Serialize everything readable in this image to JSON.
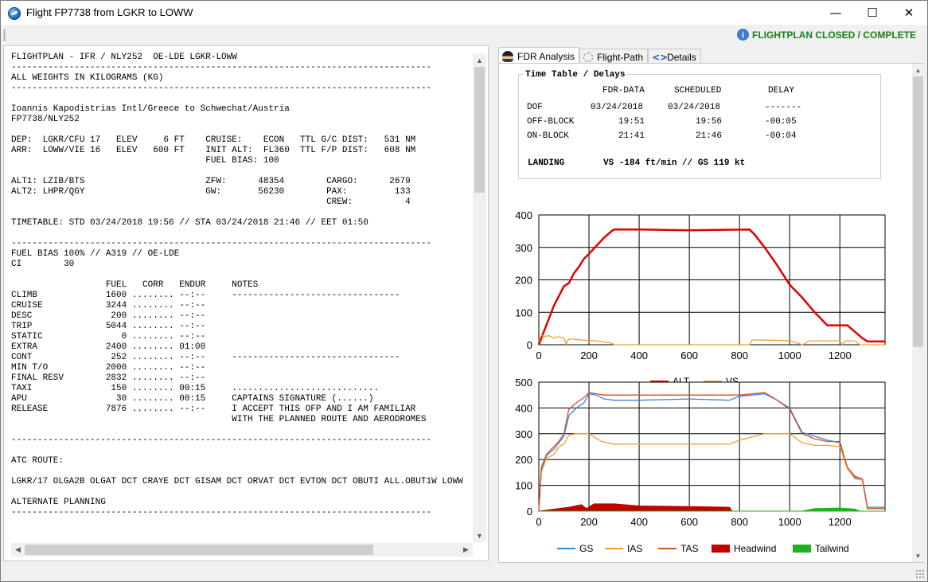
{
  "window": {
    "title": "Flight FP7738 from LGKR to LOWW",
    "minimize": "—",
    "maximize": "☐",
    "close": "✕"
  },
  "status": {
    "text": "FLIGHTPLAN CLOSED / COMPLETE",
    "color": "#1a7f1a",
    "icon": "info-icon"
  },
  "flightplan_text": "FLIGHTPLAN - IFR / NLY252  OE-LDE LGKR-LOWW\n--------------------------------------------------------------------------------\nALL WEIGHTS IN KILOGRAMS (KG)\n--------------------------------------------------------------------------------\n\nIoannis Kapodistrias Intl/Greece to Schwechat/Austria\nFP7738/NLY252\n\nDEP:  LGKR/CFU 17   ELEV     6 FT    CRUISE:    ECON   TTL G/C DIST:   531 NM\nARR:  LOWW/VIE 16   ELEV   600 FT    INIT ALT:  FL360  TTL F/P DIST:   608 NM\n                                     FUEL BIAS: 100\n\nALT1: LZIB/BTS                       ZFW:      48354        CARGO:      2679\nALT2: LHPR/QGY                       GW:       56230        PAX:         133\n                                                            CREW:          4\n\nTIMETABLE: STD 03/24/2018 19:56 // STA 03/24/2018 21:46 // EET 01:50\n\n--------------------------------------------------------------------------------\nFUEL BIAS 100% // A319 // OE-LDE\nCI        30\n\n                  FUEL   CORR   ENDUR     NOTES\nCLIMB             1600 ........ --:--     --------------------------------\nCRUISE            3244 ........ --:--\nDESC               200 ........ --:--\nTRIP              5044 ........ --:--\nSTATIC               0 ........ --:--\nEXTRA             2400 ........ 01:00\nCONT               252 ........ --:--     --------------------------------\nMIN T/O           2000 ........ --:--\nFINAL RESV        2832 ........ --:--\nTAXI               150 ........ 00:15     ............................\nAPU                 30 ........ 00:15     CAPTAINS SIGNATURE (......)\nRELEASE           7876 ........ --:--     I ACCEPT THIS OFP AND I AM FAMILIAR\n                                          WITH THE PLANNED ROUTE AND AERODROMES\n\n--------------------------------------------------------------------------------\n\nATC ROUTE:\n\nLGKR/17 OLGA2B OLGAT DCT CRAYE DCT GISAM DCT ORVAT DCT EVTON DCT OBUTI ALL.OBUT1W LOWW\n\nALTERNATE PLANNING\n--------------------------------------------------------------------------------",
  "tabs": [
    {
      "label": "FDR Analysis",
      "icon": "pilot-icon",
      "active": true
    },
    {
      "label": "Flight-Path",
      "icon": "route-icon",
      "active": false
    },
    {
      "label": "Details",
      "icon": "details-icon",
      "active": false
    }
  ],
  "timetable": {
    "title": "Time Table / Delays",
    "col_fdr": "FDR-DATA",
    "col_sched": "SCHEDULED",
    "col_delay": "DELAY",
    "rows": [
      {
        "label": "DOF",
        "fdr": "03/24/2018",
        "sched": "03/24/2018",
        "delay": "-------"
      },
      {
        "label": "OFF-BLOCK",
        "fdr": "19:51",
        "sched": "19:56",
        "delay": "-00:05"
      },
      {
        "label": "ON-BLOCK",
        "fdr": "21:41",
        "sched": "21:46",
        "delay": "-00:04"
      }
    ],
    "landing_label": "LANDING",
    "landing_value": "VS -184 ft/min // GS 119 kt"
  },
  "chart_data": [
    {
      "type": "line",
      "xlim": [
        0,
        1380
      ],
      "ylim": [
        0,
        400
      ],
      "xticks": [
        "0",
        "200",
        "400",
        "600",
        "800",
        "1000",
        "1200"
      ],
      "yticks": [
        "0",
        "100",
        "200",
        "300",
        "400"
      ],
      "grid": true,
      "legend": "bottom",
      "series": [
        {
          "name": "ALT",
          "color": "#e00000",
          "points": [
            [
              0,
              0
            ],
            [
              20,
              40
            ],
            [
              40,
              80
            ],
            [
              60,
              120
            ],
            [
              80,
              150
            ],
            [
              100,
              180
            ],
            [
              120,
              190
            ],
            [
              140,
              220
            ],
            [
              160,
              240
            ],
            [
              180,
              265
            ],
            [
              200,
              280
            ],
            [
              230,
              305
            ],
            [
              260,
              330
            ],
            [
              290,
              350
            ],
            [
              300,
              355
            ],
            [
              400,
              355
            ],
            [
              600,
              353
            ],
            [
              840,
              355
            ],
            [
              860,
              340
            ],
            [
              900,
              300
            ],
            [
              950,
              245
            ],
            [
              1000,
              185
            ],
            [
              1050,
              145
            ],
            [
              1100,
              100
            ],
            [
              1150,
              60
            ],
            [
              1200,
              60
            ],
            [
              1230,
              60
            ],
            [
              1260,
              40
            ],
            [
              1290,
              20
            ],
            [
              1310,
              10
            ],
            [
              1380,
              10
            ]
          ]
        },
        {
          "name": "VS",
          "color": "#f0a030",
          "points": [
            [
              0,
              10
            ],
            [
              10,
              30
            ],
            [
              20,
              25
            ],
            [
              40,
              28
            ],
            [
              60,
              20
            ],
            [
              80,
              25
            ],
            [
              100,
              20
            ],
            [
              110,
              0
            ],
            [
              115,
              15
            ],
            [
              130,
              18
            ],
            [
              180,
              14
            ],
            [
              230,
              12
            ],
            [
              290,
              5
            ],
            [
              300,
              0
            ],
            [
              840,
              0
            ],
            [
              850,
              15
            ],
            [
              900,
              14
            ],
            [
              1000,
              13
            ],
            [
              1050,
              0
            ],
            [
              1080,
              12
            ],
            [
              1150,
              12
            ],
            [
              1200,
              12
            ],
            [
              1210,
              0
            ],
            [
              1225,
              12
            ],
            [
              1260,
              12
            ],
            [
              1280,
              0
            ],
            [
              1380,
              0
            ]
          ]
        }
      ]
    },
    {
      "type": "line",
      "xlim": [
        0,
        1380
      ],
      "ylim": [
        0,
        500
      ],
      "xticks": [
        "0",
        "200",
        "400",
        "600",
        "800",
        "1000",
        "1200"
      ],
      "yticks": [
        "0",
        "100",
        "200",
        "300",
        "400",
        "500"
      ],
      "grid": true,
      "legend": "bottom",
      "series": [
        {
          "name": "GS",
          "color": "#3a86d4",
          "points": [
            [
              0,
              0
            ],
            [
              10,
              160
            ],
            [
              30,
              215
            ],
            [
              60,
              240
            ],
            [
              80,
              265
            ],
            [
              100,
              290
            ],
            [
              120,
              370
            ],
            [
              150,
              400
            ],
            [
              180,
              420
            ],
            [
              200,
              455
            ],
            [
              230,
              450
            ],
            [
              260,
              435
            ],
            [
              300,
              430
            ],
            [
              400,
              430
            ],
            [
              600,
              435
            ],
            [
              760,
              430
            ],
            [
              800,
              445
            ],
            [
              900,
              455
            ],
            [
              950,
              430
            ],
            [
              1000,
              400
            ],
            [
              1050,
              305
            ],
            [
              1100,
              290
            ],
            [
              1150,
              275
            ],
            [
              1200,
              265
            ],
            [
              1230,
              170
            ],
            [
              1260,
              130
            ],
            [
              1290,
              125
            ],
            [
              1310,
              15
            ],
            [
              1380,
              15
            ]
          ]
        },
        {
          "name": "IAS",
          "color": "#f0a030",
          "points": [
            [
              0,
              0
            ],
            [
              10,
              150
            ],
            [
              30,
              205
            ],
            [
              60,
              220
            ],
            [
              80,
              250
            ],
            [
              100,
              260
            ],
            [
              120,
              295
            ],
            [
              150,
              300
            ],
            [
              200,
              300
            ],
            [
              250,
              270
            ],
            [
              300,
              260
            ],
            [
              500,
              260
            ],
            [
              760,
              260
            ],
            [
              800,
              275
            ],
            [
              900,
              300
            ],
            [
              1000,
              300
            ],
            [
              1050,
              265
            ],
            [
              1100,
              255
            ],
            [
              1150,
              255
            ],
            [
              1200,
              250
            ],
            [
              1230,
              165
            ],
            [
              1260,
              125
            ],
            [
              1290,
              120
            ],
            [
              1310,
              10
            ],
            [
              1380,
              10
            ]
          ]
        },
        {
          "name": "TAS",
          "color": "#d2502a",
          "points": [
            [
              0,
              0
            ],
            [
              10,
              170
            ],
            [
              30,
              220
            ],
            [
              60,
              250
            ],
            [
              80,
              270
            ],
            [
              100,
              300
            ],
            [
              120,
              395
            ],
            [
              150,
              420
            ],
            [
              180,
              440
            ],
            [
              200,
              460
            ],
            [
              230,
              455
            ],
            [
              260,
              450
            ],
            [
              400,
              450
            ],
            [
              600,
              450
            ],
            [
              760,
              450
            ],
            [
              800,
              450
            ],
            [
              900,
              460
            ],
            [
              950,
              430
            ],
            [
              1000,
              395
            ],
            [
              1050,
              300
            ],
            [
              1100,
              280
            ],
            [
              1150,
              270
            ],
            [
              1200,
              270
            ],
            [
              1230,
              170
            ],
            [
              1260,
              135
            ],
            [
              1290,
              125
            ],
            [
              1310,
              10
            ],
            [
              1380,
              10
            ]
          ]
        },
        {
          "name": "Headwind",
          "color": "#c00000",
          "points": [
            [
              0,
              0
            ],
            [
              120,
              15
            ],
            [
              170,
              25
            ],
            [
              190,
              10
            ],
            [
              220,
              28
            ],
            [
              300,
              28
            ],
            [
              400,
              20
            ],
            [
              600,
              18
            ],
            [
              760,
              15
            ],
            [
              770,
              0
            ],
            [
              1380,
              0
            ]
          ]
        },
        {
          "name": "Tailwind",
          "color": "#20b020",
          "points": [
            [
              0,
              0
            ],
            [
              900,
              0
            ],
            [
              1050,
              0
            ],
            [
              1100,
              10
            ],
            [
              1200,
              12
            ],
            [
              1260,
              8
            ],
            [
              1280,
              0
            ],
            [
              1380,
              0
            ]
          ]
        }
      ]
    }
  ]
}
